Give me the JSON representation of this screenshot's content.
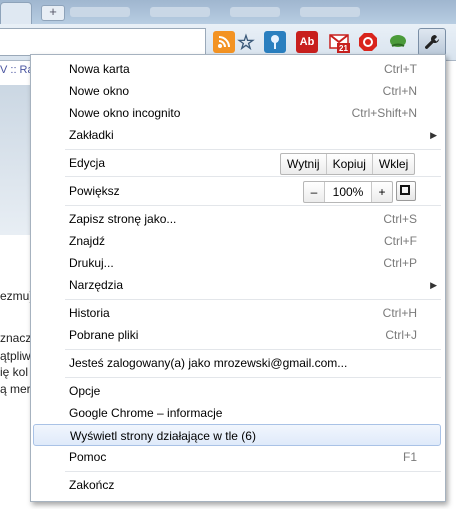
{
  "page_behind": {
    "bookmark_fragment": "V :: Ra",
    "text_lines": [
      "ezmu)",
      "znacz",
      "ątpliw",
      "ię kol",
      "ą mer"
    ]
  },
  "toolbar": {
    "extensions": [
      {
        "icon": "rss-icon",
        "label": "",
        "color": "#f39323"
      },
      {
        "icon": "star-icon",
        "label": "☆",
        "color": "#3b5a7a"
      },
      {
        "icon": "pushpin-icon",
        "label": "",
        "color": "#2a7fbf"
      },
      {
        "icon": "adblock-icon",
        "label": "Ab",
        "color": "#c8201e"
      },
      {
        "icon": "gmail-icon",
        "label": "21",
        "color": "#c8201e"
      },
      {
        "icon": "stop-icon",
        "label": "✋",
        "color": "#d9241c"
      },
      {
        "icon": "leaf-icon",
        "label": "",
        "color": "#4b9b3a"
      }
    ],
    "wrench_icon": "wrench-icon"
  },
  "menu": {
    "items": [
      {
        "label": "Nowa karta",
        "shortcut": "Ctrl+T"
      },
      {
        "label": "Nowe okno",
        "shortcut": "Ctrl+N"
      },
      {
        "label": "Nowe okno incognito",
        "shortcut": "Ctrl+Shift+N"
      },
      {
        "label": "Zakładki",
        "shortcut": ""
      },
      {
        "label": "Edycja",
        "shortcut": ""
      },
      {
        "label": "Powiększ",
        "shortcut": ""
      },
      {
        "label": "Zapisz stronę jako...",
        "shortcut": "Ctrl+S"
      },
      {
        "label": "Znajdź",
        "shortcut": "Ctrl+F"
      },
      {
        "label": "Drukuj...",
        "shortcut": "Ctrl+P"
      },
      {
        "label": "Narzędzia",
        "shortcut": ""
      },
      {
        "label": "Historia",
        "shortcut": "Ctrl+H"
      },
      {
        "label": "Pobrane pliki",
        "shortcut": "Ctrl+J"
      },
      {
        "label": "Jesteś zalogowany(a) jako mrozewski@gmail.com...",
        "shortcut": ""
      },
      {
        "label": "Opcje",
        "shortcut": ""
      },
      {
        "label": "Google Chrome – informacje",
        "shortcut": ""
      },
      {
        "label": "Wyświetl strony działające w tle (6)",
        "shortcut": ""
      },
      {
        "label": "Pomoc",
        "shortcut": "F1"
      },
      {
        "label": "Zakończ",
        "shortcut": ""
      }
    ],
    "edit_buttons": [
      "Wytnij",
      "Kopiuj",
      "Wklej"
    ],
    "zoom": {
      "minus": "–",
      "value": "100%",
      "plus": "+"
    },
    "submenu_arrow": "▶"
  }
}
